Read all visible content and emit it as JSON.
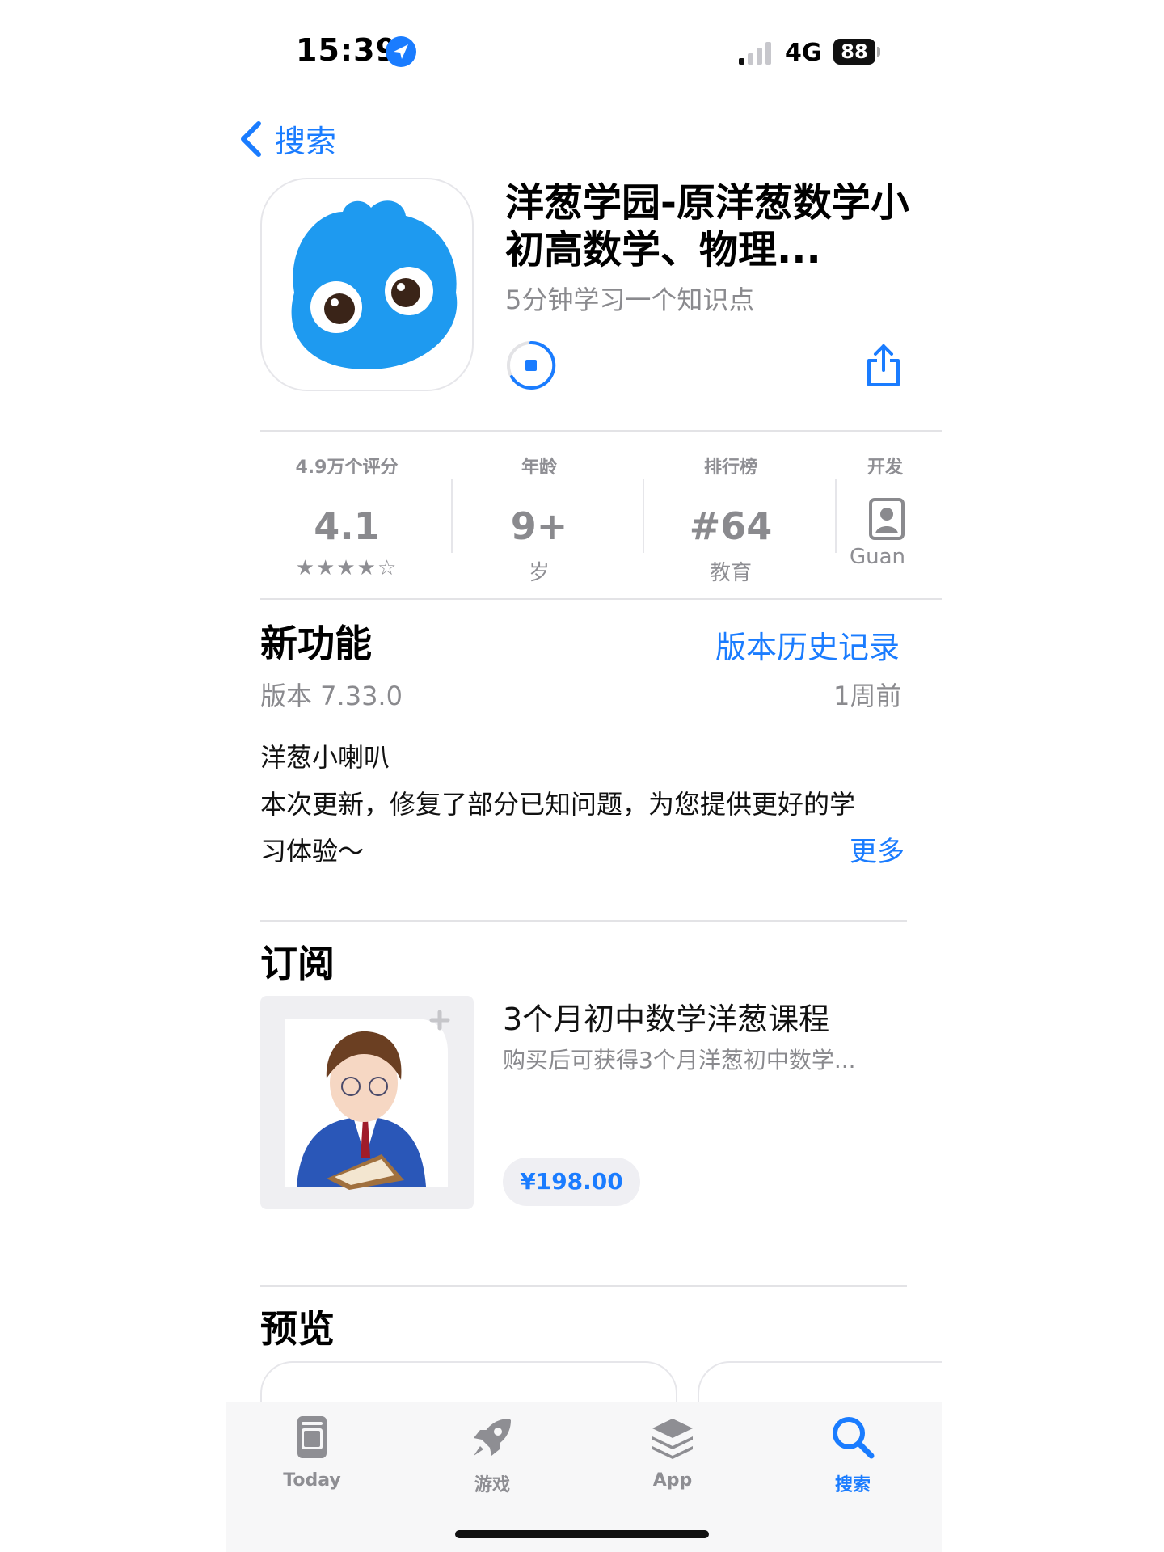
{
  "status_bar": {
    "time": "15:39",
    "network": "4G",
    "battery": "88"
  },
  "nav": {
    "back_label": "搜索"
  },
  "app": {
    "title": "洋葱学园-原洋葱数学小初高数学、物理...",
    "subtitle": "5分钟学习一个知识点"
  },
  "info": [
    {
      "label": "4.9万个评分",
      "value": "4.1",
      "sub": "★★★★☆"
    },
    {
      "label": "年龄",
      "value": "9+",
      "sub": "岁"
    },
    {
      "label": "排行榜",
      "value": "#64",
      "sub": "教育"
    },
    {
      "label": "开发",
      "value": "",
      "sub": "Guan"
    }
  ],
  "whats_new": {
    "title": "新功能",
    "history_link": "版本历史记录",
    "version": "版本 7.33.0",
    "time_ago": "1周前",
    "line1": "洋葱小喇叭",
    "line2": "本次更新，修复了部分已知问题，为您提供更好的学",
    "line3": "习体验～",
    "more": "更多"
  },
  "subscription": {
    "title": "订阅",
    "item_title": "3个月初中数学洋葱课程",
    "item_desc": "购买后可获得3个月洋葱初中数学...",
    "price": "¥198.00"
  },
  "preview": {
    "title": "预览"
  },
  "tabbar": {
    "items": [
      {
        "label": "Today",
        "icon": "today-icon"
      },
      {
        "label": "游戏",
        "icon": "rocket-icon"
      },
      {
        "label": "App",
        "icon": "app-stack-icon"
      },
      {
        "label": "搜索",
        "icon": "search-icon"
      }
    ]
  },
  "colors": {
    "accent": "#1a7cff",
    "icon_blue": "#1e9af0"
  }
}
